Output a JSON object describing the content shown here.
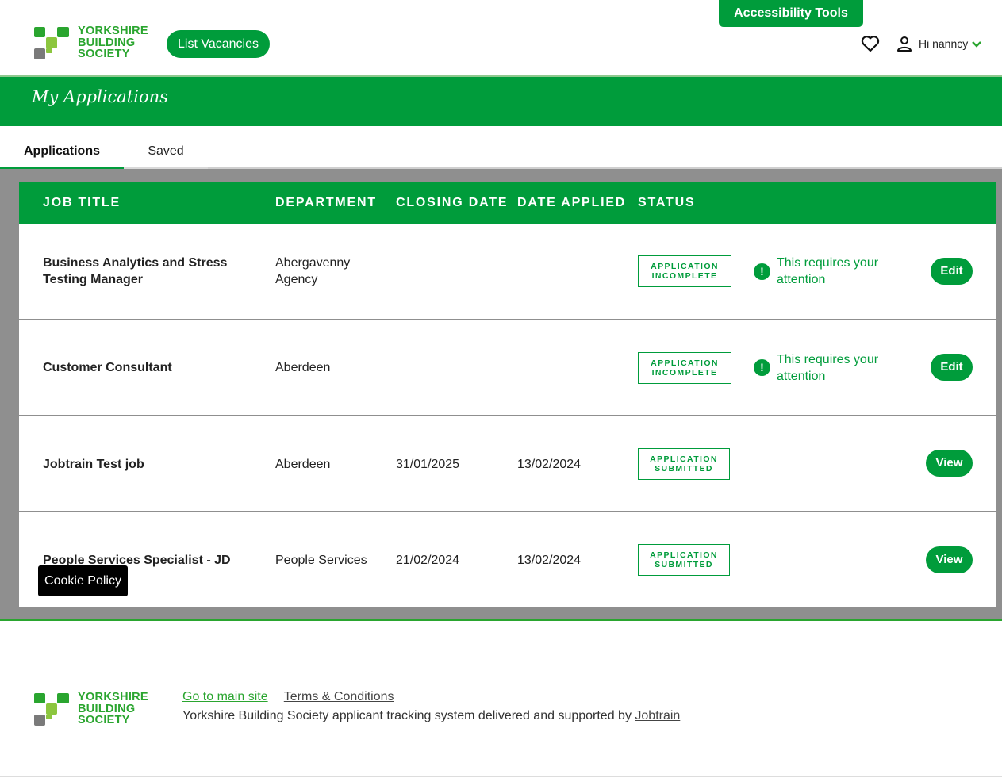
{
  "header": {
    "logo_lines": [
      "YORKSHIRE",
      "BUILDING",
      "SOCIETY"
    ],
    "list_vacancies": "List Vacancies",
    "accessibility_tools": "Accessibility Tools",
    "user_greeting": "Hi nanncy",
    "icons": [
      "heart-icon",
      "user-icon",
      "chevron-down-icon"
    ]
  },
  "banner": {
    "title": "My Applications"
  },
  "tabs": [
    {
      "label": "Applications",
      "active": true
    },
    {
      "label": "Saved",
      "active": false
    }
  ],
  "table": {
    "columns": [
      "JOB TITLE",
      "DEPARTMENT",
      "CLOSING DATE",
      "DATE APPLIED",
      "STATUS"
    ],
    "rows": [
      {
        "title_lines": [
          "Business Analytics and Stress",
          "Testing Manager"
        ],
        "department_lines": [
          "Abergavenny",
          "Agency"
        ],
        "closing_date": "",
        "date_applied": "",
        "status_lines": [
          "APPLICATION",
          "INCOMPLETE"
        ],
        "attention_lines": [
          "This requires your",
          "attention"
        ],
        "action": "Edit"
      },
      {
        "title_lines": [
          "Customer Consultant"
        ],
        "department_lines": [
          "Aberdeen"
        ],
        "closing_date": "",
        "date_applied": "",
        "status_lines": [
          "APPLICATION",
          "INCOMPLETE"
        ],
        "attention_lines": [
          "This requires your",
          "attention"
        ],
        "action": "Edit"
      },
      {
        "title_lines": [
          "Jobtrain Test job"
        ],
        "department_lines": [
          "Aberdeen"
        ],
        "closing_date": "31/01/2025",
        "date_applied": "13/02/2024",
        "status_lines": [
          "APPLICATION",
          "SUBMITTED"
        ],
        "attention_lines": [],
        "action": "View"
      },
      {
        "title_lines": [
          "People Services Specialist - JD"
        ],
        "department_lines": [
          "People Services"
        ],
        "closing_date": "21/02/2024",
        "date_applied": "13/02/2024",
        "status_lines": [
          "APPLICATION",
          "SUBMITTED"
        ],
        "attention_lines": [],
        "action": "View"
      }
    ]
  },
  "cookie_policy": "Cookie Policy",
  "footer": {
    "link_main_site": "Go to main site",
    "link_terms": "Terms & Conditions",
    "text_prefix": "Yorkshire Building Society applicant tracking system delivered and supported by ",
    "link_jobtrain": "Jobtrain"
  },
  "colors": {
    "brand_green": "#009c3b",
    "logo_green": "#2aa52f",
    "gray_bg": "#8f8f8f"
  }
}
